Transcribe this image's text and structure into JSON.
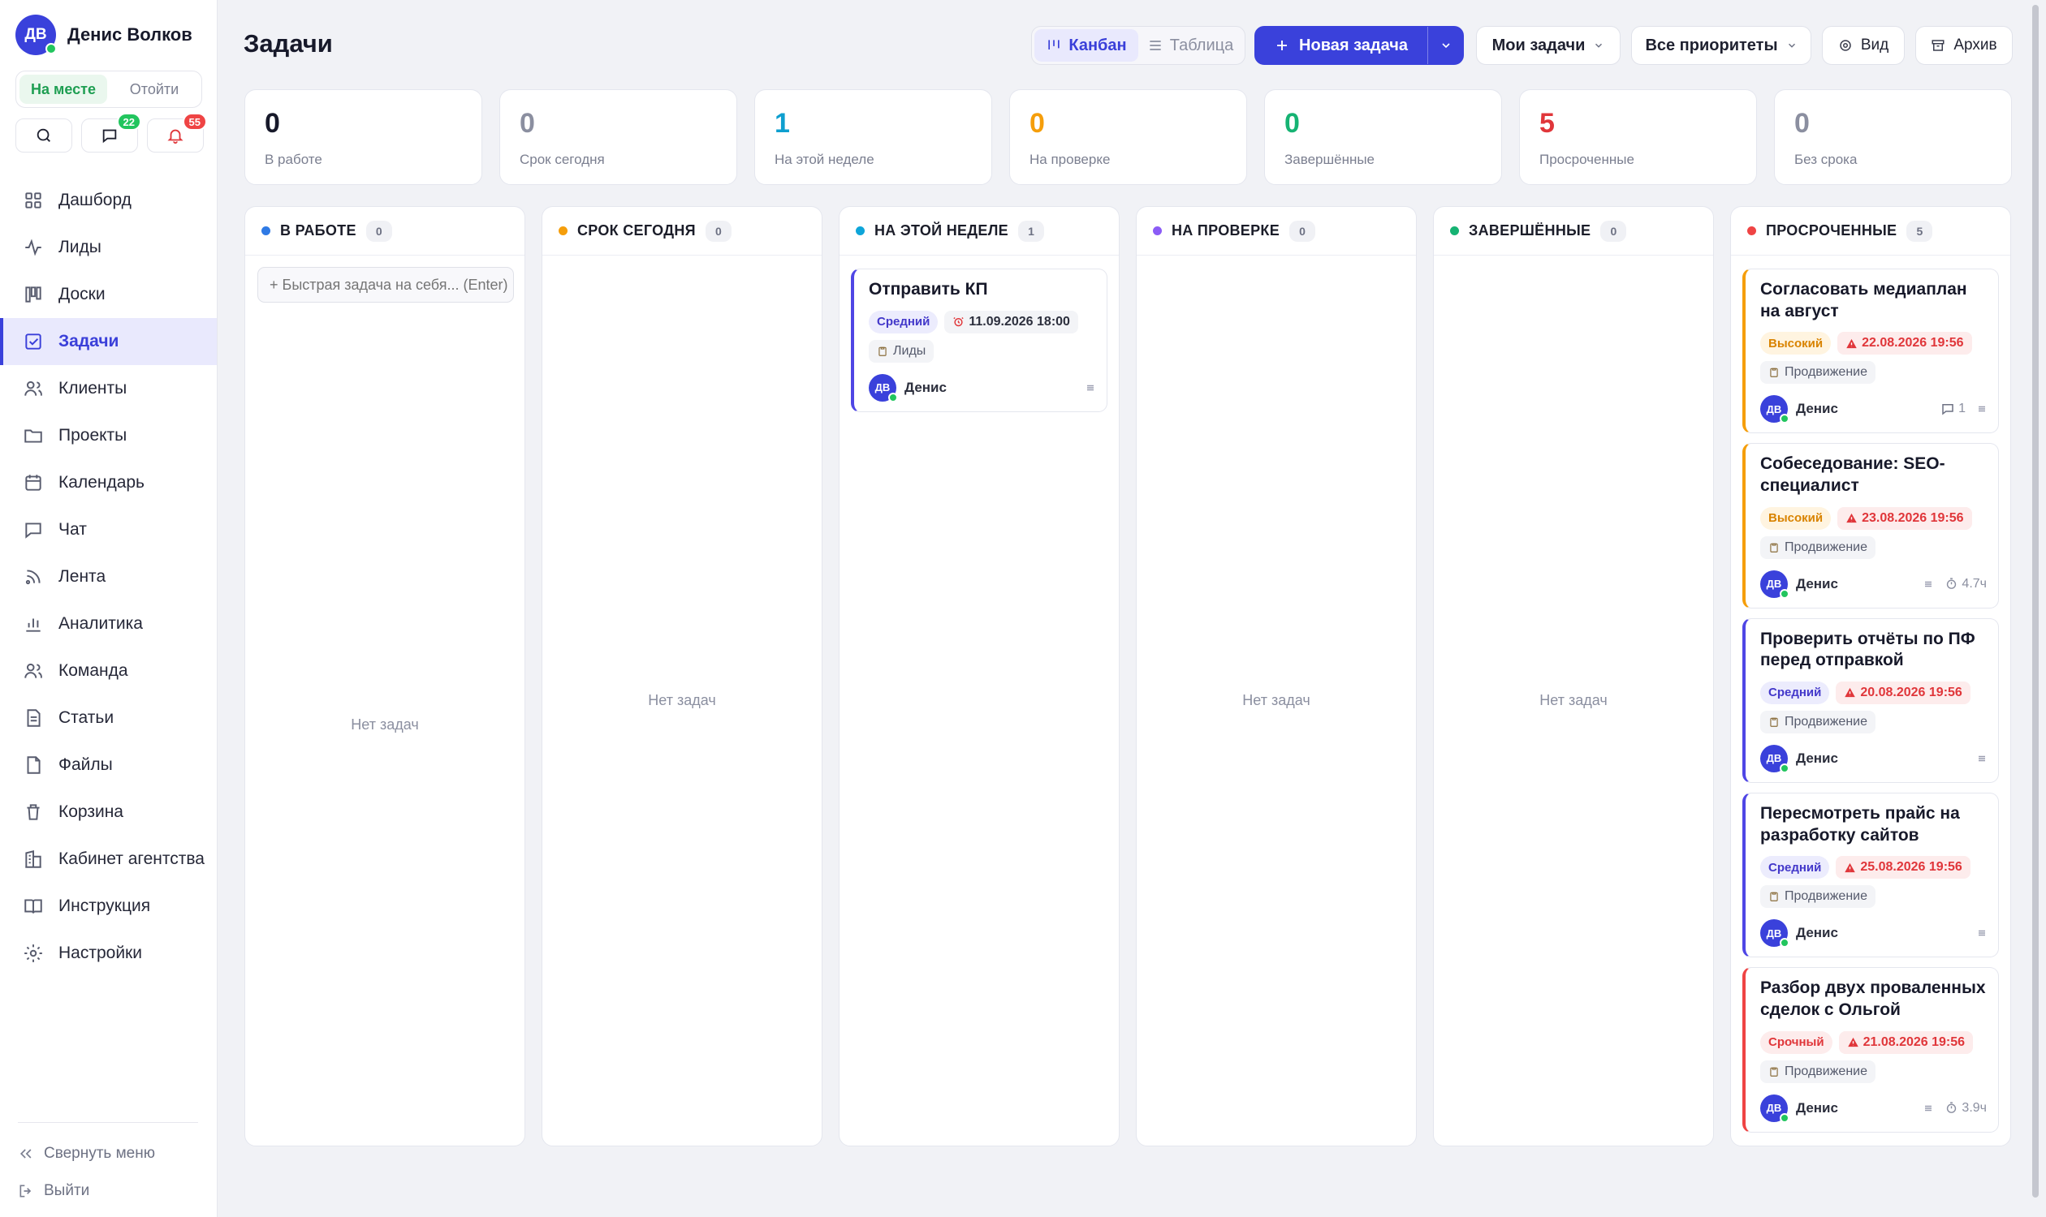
{
  "user": {
    "initials": "ДВ",
    "name": "Денис Волков"
  },
  "status": {
    "on": "На месте",
    "away": "Отойти"
  },
  "quick": {
    "messages_badge": "22",
    "notifications_badge": "55"
  },
  "nav": [
    "Дашборд",
    "Лиды",
    "Доски",
    "Задачи",
    "Клиенты",
    "Проекты",
    "Календарь",
    "Чат",
    "Лента",
    "Аналитика",
    "Команда",
    "Статьи",
    "Файлы",
    "Корзина",
    "Кабинет агентства",
    "Инструкция",
    "Настройки"
  ],
  "nav_active": "Задачи",
  "sidebar_footer": {
    "collapse": "Свернуть меню",
    "logout": "Выйти"
  },
  "page_title": "Задачи",
  "toolbar": {
    "kanban": "Канбан",
    "table": "Таблица",
    "new_task": "Новая задача",
    "my_tasks": "Мои задачи",
    "priorities": "Все приоритеты",
    "view": "Вид",
    "archive": "Архив"
  },
  "stats": [
    {
      "value": "0",
      "label": "В работе",
      "color": "#17192a"
    },
    {
      "value": "0",
      "label": "Срок сегодня",
      "color": "#8b8fa0"
    },
    {
      "value": "1",
      "label": "На этой неделе",
      "color": "#0e9fcf"
    },
    {
      "value": "0",
      "label": "На проверке",
      "color": "#f59e0b"
    },
    {
      "value": "0",
      "label": "Завершённые",
      "color": "#16b373"
    },
    {
      "value": "5",
      "label": "Просроченные",
      "color": "#e0363a"
    },
    {
      "value": "0",
      "label": "Без срока",
      "color": "#8b8fa0"
    }
  ],
  "empty_text": "Нет задач",
  "quick_task_placeholder": "+ Быстрая задача на себя... (Enter)",
  "columns": [
    {
      "title": "В РАБОТЕ",
      "count": "0",
      "dot": "#2f7ae5"
    },
    {
      "title": "СРОК СЕГОДНЯ",
      "count": "0",
      "dot": "#f59e0b"
    },
    {
      "title": "НА ЭТОЙ НЕДЕЛЕ",
      "count": "1",
      "dot": "#0ea5d9"
    },
    {
      "title": "НА ПРОВЕРКЕ",
      "count": "0",
      "dot": "#8b5cf6"
    },
    {
      "title": "ЗАВЕРШЁННЫЕ",
      "count": "0",
      "dot": "#16b373"
    },
    {
      "title": "ПРОСРОЧЕННЫЕ",
      "count": "5",
      "dot": "#ef4444"
    }
  ],
  "week_card": {
    "title": "Отправить КП",
    "priority": "Средний",
    "date": "11.09.2026 18:00",
    "tag": "Лиды",
    "assignee": "Денис",
    "initials": "ДВ"
  },
  "overdue_cards": [
    {
      "title": "Согласовать медиаплан на август",
      "priority": "Высокий",
      "date": "22.08.2026 19:56",
      "tag": "Продвижение",
      "assignee": "Денис",
      "initials": "ДВ",
      "comments": "1",
      "time": ""
    },
    {
      "title": "Собеседование: SEO-специалист",
      "priority": "Высокий",
      "date": "23.08.2026 19:56",
      "tag": "Продвижение",
      "assignee": "Денис",
      "initials": "ДВ",
      "comments": "",
      "time": "4.7ч"
    },
    {
      "title": "Проверить отчёты по ПФ перед отправкой",
      "priority": "Средний",
      "date": "20.08.2026 19:56",
      "tag": "Продвижение",
      "assignee": "Денис",
      "initials": "ДВ",
      "comments": "",
      "time": ""
    },
    {
      "title": "Пересмотреть прайс на разработку сайтов",
      "priority": "Средний",
      "date": "25.08.2026 19:56",
      "tag": "Продвижение",
      "assignee": "Денис",
      "initials": "ДВ",
      "comments": "",
      "time": ""
    },
    {
      "title": "Разбор двух проваленных сделок с Ольгой",
      "priority": "Срочный",
      "date": "21.08.2026 19:56",
      "tag": "Продвижение",
      "assignee": "Денис",
      "initials": "ДВ",
      "comments": "",
      "time": "3.9ч"
    }
  ],
  "colors": {
    "accent": "#3a41db",
    "high": "#f59e0b",
    "medium": "#4f46e5",
    "urgent": "#ef4444",
    "online": "#22c55e"
  }
}
